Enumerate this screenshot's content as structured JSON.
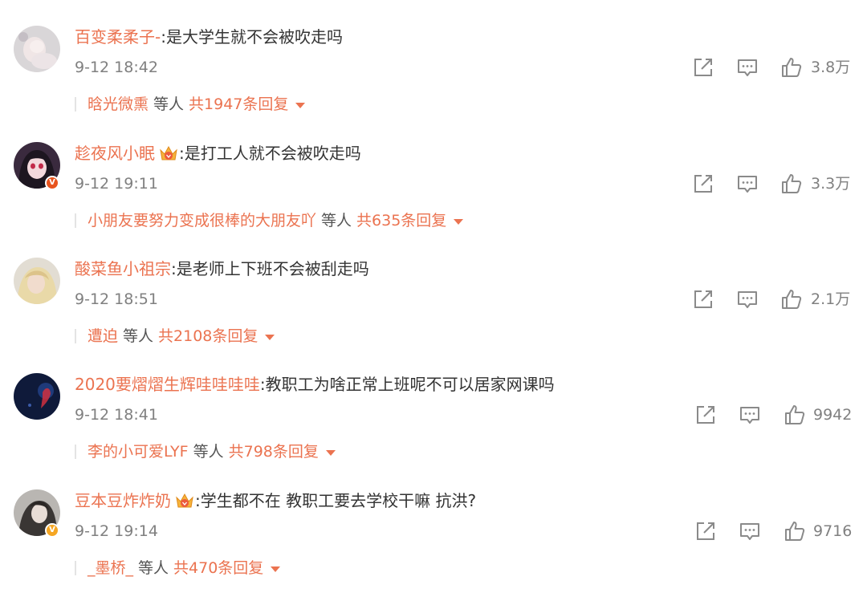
{
  "comments": [
    {
      "user": "百变柔柔子-",
      "text": ":是大学生就不会被吹走吗",
      "time": "9-12 18:42",
      "likes": "3.8万",
      "reply_user": "晗光微熏",
      "reply_mid": "等人",
      "reply_total": "共1947条回复",
      "crown": false,
      "verified": false
    },
    {
      "user": "趁夜风小眠",
      "text": ":是打工人就不会被吹走吗",
      "time": "9-12 19:11",
      "likes": "3.3万",
      "reply_user": "小朋友要努力变成很棒的大朋友吖",
      "reply_mid": "等人",
      "reply_total": "共635条回复",
      "crown": true,
      "verified": true,
      "verified_color": "#e8541e"
    },
    {
      "user": "酸菜鱼小祖宗",
      "text": ":是老师上下班不会被刮走吗",
      "time": "9-12 18:51",
      "likes": "2.1万",
      "reply_user": "遭迫",
      "reply_mid": "等人",
      "reply_total": "共2108条回复",
      "crown": false,
      "verified": false
    },
    {
      "user": "2020要熠熠生辉哇哇哇哇",
      "text": ":教职工为啥正常上班呢不可以居家网课吗",
      "time": "9-12 18:41",
      "likes": "9942",
      "reply_user": "李的小可爱LYF",
      "reply_mid": "等人",
      "reply_total": "共798条回复",
      "crown": false,
      "verified": false
    },
    {
      "user": "豆本豆炸炸奶",
      "text": ":学生都不在 教职工要去学校干嘛 抗洪?",
      "time": "9-12 19:14",
      "likes": "9716",
      "reply_user": "_墨桥_",
      "reply_mid": "等人",
      "reply_total": "共470条回复",
      "crown": true,
      "verified": true,
      "verified_color": "#f5a623"
    }
  ],
  "icons": {
    "share": "share-icon",
    "comment": "comment-icon",
    "like": "thumbs-up-icon",
    "dropdown": "caret-down-icon"
  },
  "colors": {
    "accent": "#eb7350",
    "muted": "#808080",
    "text": "#333333"
  }
}
